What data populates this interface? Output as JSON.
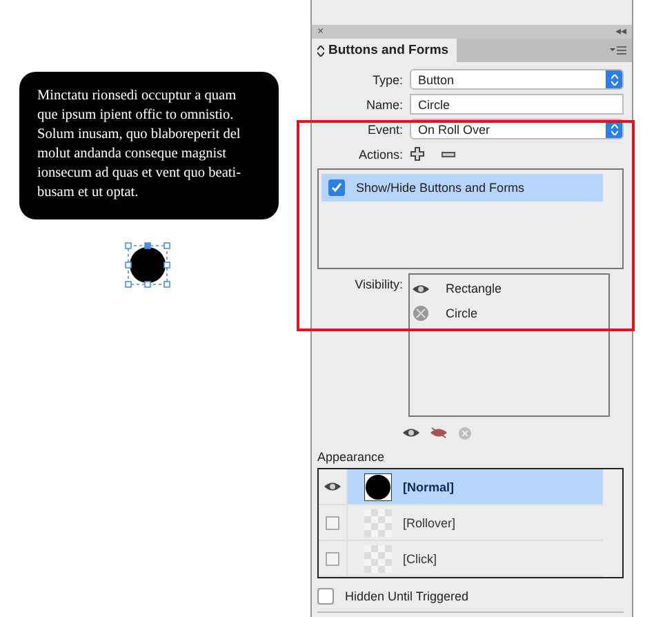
{
  "text_frame": {
    "lines": [
      "Minctatu rionsedi occuptur a quam",
      "que ipsum ipient offic to omnistio.",
      "Solum inusam, quo blaboreperit del",
      "molut andanda conseque magnist",
      "ionsecum ad quas et vent quo beati-",
      "busam et ut optat."
    ]
  },
  "panel": {
    "close": "×",
    "collapse": "◂◂",
    "title": "Buttons and Forms",
    "fields": [
      {
        "label": "Type:",
        "value": "Button",
        "kind": "select"
      },
      {
        "label": "Name:",
        "value": "Circle",
        "kind": "text"
      },
      {
        "label": "Event:",
        "value": "On Roll Over",
        "kind": "select"
      }
    ],
    "actions_label": "Actions:",
    "actions": [
      {
        "label": "Show/Hide Buttons and Forms",
        "checked": true,
        "selected": true
      }
    ],
    "visibility_label": "Visibility:",
    "visibility": [
      {
        "label": "Rectangle",
        "visible": true
      },
      {
        "label": "Circle",
        "visible": false
      }
    ],
    "appearance_label": "Appearance",
    "appearance": [
      {
        "label": "[Normal]",
        "selected": true,
        "visible": true,
        "kind": "filled"
      },
      {
        "label": "[Rollover]",
        "selected": false,
        "visible": false,
        "kind": "empty"
      },
      {
        "label": "[Click]",
        "selected": false,
        "visible": false,
        "kind": "empty"
      }
    ],
    "hidden_until_triggered": {
      "label": "Hidden Until Triggered",
      "checked": false
    }
  }
}
